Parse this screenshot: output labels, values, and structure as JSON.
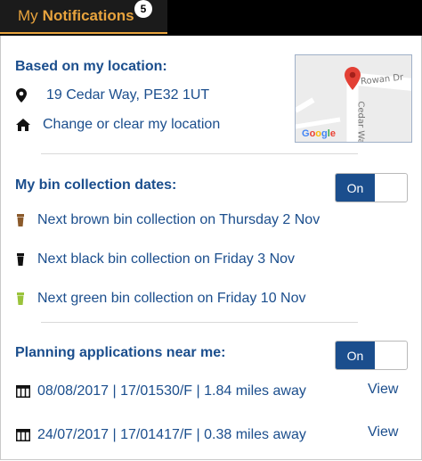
{
  "tab": {
    "label_prefix": "My",
    "label_strong": "Notifications",
    "badge_count": "5"
  },
  "location": {
    "heading": "Based on my location:",
    "address": "19 Cedar Way, PE32 1UT",
    "change_link": "Change or clear my location",
    "map": {
      "road_1": "Rowan Dr",
      "road_2": "Cedar Wa",
      "brand": "Google"
    }
  },
  "bins": {
    "heading": "My bin collection dates:",
    "toggle_label": "On",
    "items": [
      {
        "text": "Next brown bin collection on Thursday 2 Nov",
        "color": "#8b5a2b"
      },
      {
        "text": "Next black bin collection on Friday 3 Nov",
        "color": "#111111"
      },
      {
        "text": "Next green bin collection on Friday 10 Nov",
        "color": "#9ac33b"
      }
    ]
  },
  "planning": {
    "heading": "Planning applications near me:",
    "toggle_label": "On",
    "items": [
      {
        "text": "08/08/2017 | 17/01530/F | 1.84 miles away",
        "action": "View"
      },
      {
        "text": "24/07/2017 | 17/01417/F | 0.38 miles away",
        "action": "View"
      }
    ]
  },
  "colors": {
    "accent": "#e8a33d",
    "primary": "#1b4e8d"
  }
}
